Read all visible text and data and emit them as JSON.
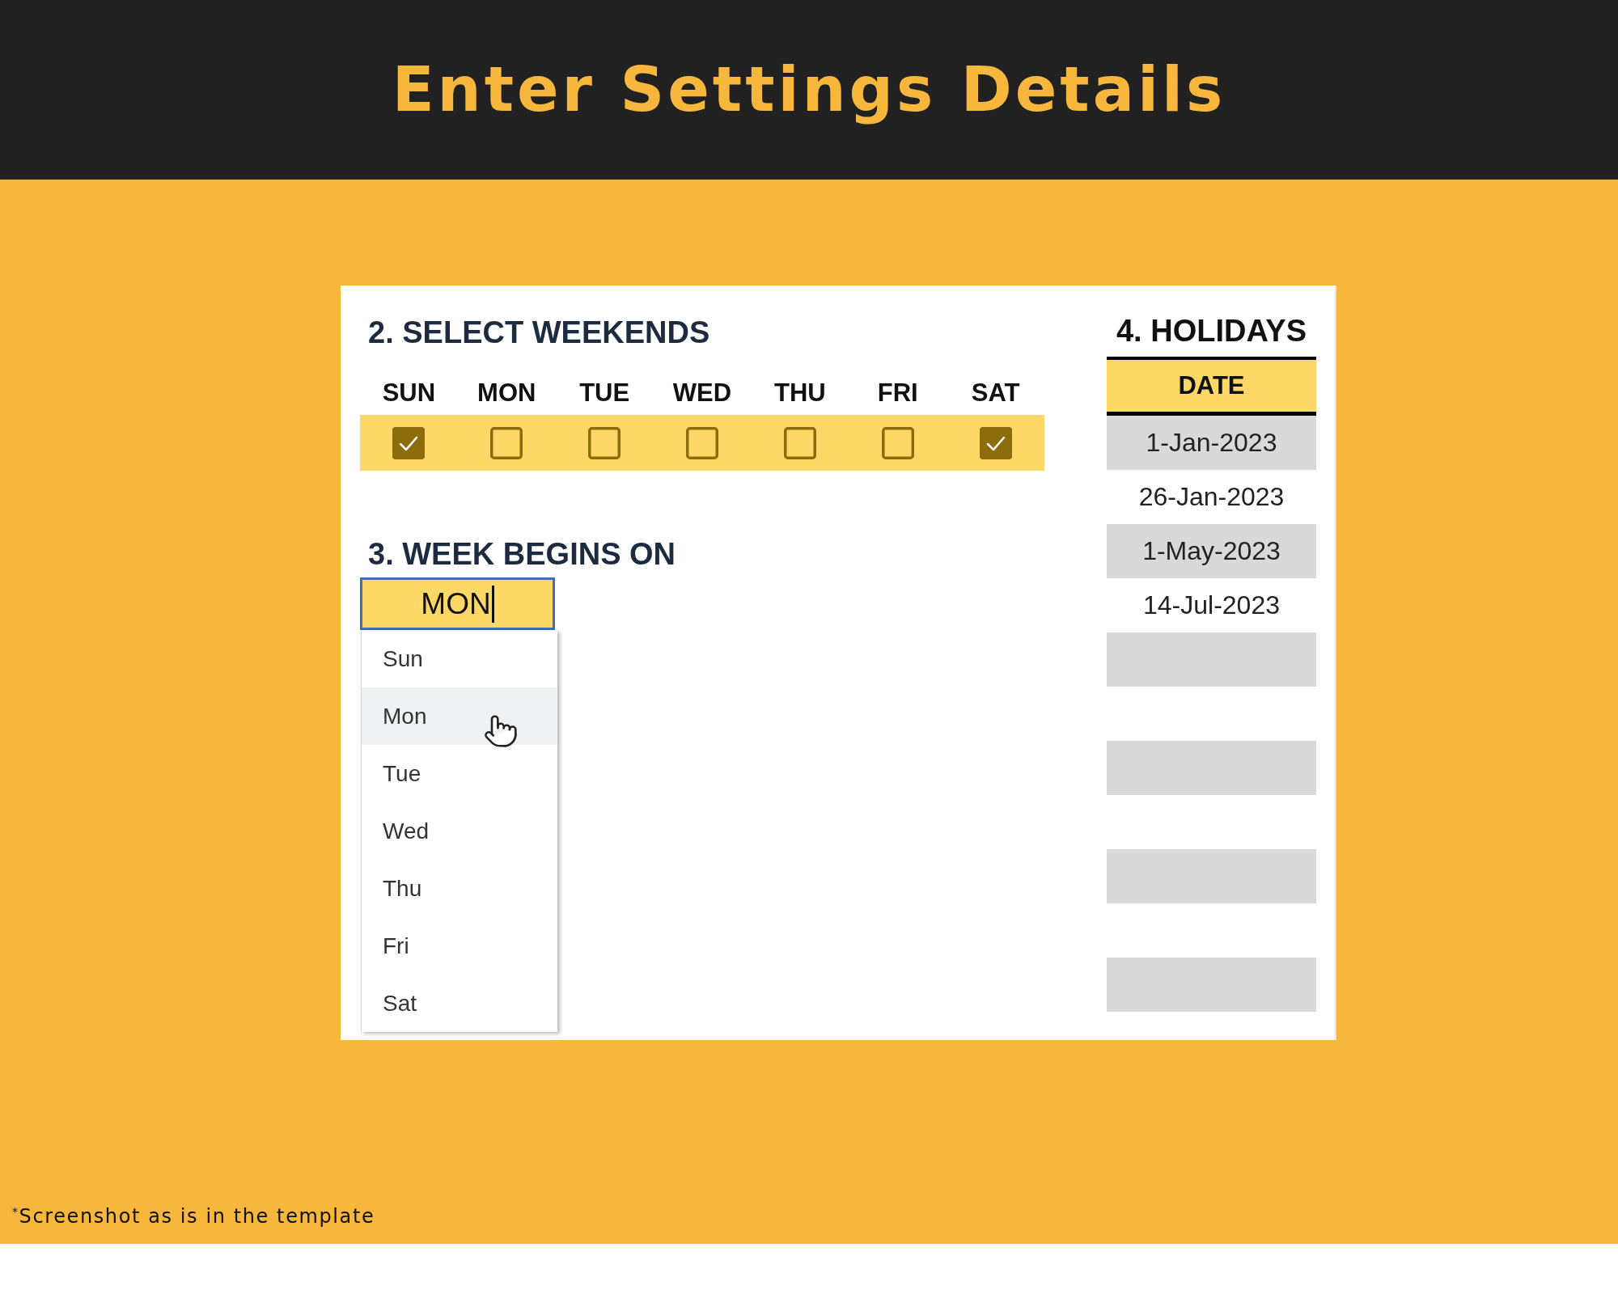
{
  "header": {
    "title": "Enter Settings Details"
  },
  "weekends": {
    "title": "2. SELECT WEEKENDS",
    "days": [
      {
        "label": "SUN",
        "checked": true
      },
      {
        "label": "MON",
        "checked": false
      },
      {
        "label": "TUE",
        "checked": false
      },
      {
        "label": "WED",
        "checked": false
      },
      {
        "label": "THU",
        "checked": false
      },
      {
        "label": "FRI",
        "checked": false
      },
      {
        "label": "SAT",
        "checked": true
      }
    ]
  },
  "week_start": {
    "title": "3. WEEK BEGINS ON",
    "value": "MON",
    "options": [
      {
        "label": "Sun",
        "selected": false
      },
      {
        "label": "Mon",
        "selected": true
      },
      {
        "label": "Tue",
        "selected": false
      },
      {
        "label": "Wed",
        "selected": false
      },
      {
        "label": "Thu",
        "selected": false
      },
      {
        "label": "Fri",
        "selected": false
      },
      {
        "label": "Sat",
        "selected": false
      }
    ]
  },
  "holidays": {
    "title": "4. HOLIDAYS",
    "column": "DATE",
    "rows": [
      {
        "kind": "date",
        "date": "1-Jan-2023"
      },
      {
        "kind": "date",
        "date": "26-Jan-2023"
      },
      {
        "kind": "date",
        "date": "1-May-2023"
      },
      {
        "kind": "date",
        "date": "14-Jul-2023"
      },
      {
        "kind": "blank"
      },
      {
        "kind": "blank"
      },
      {
        "kind": "blank"
      },
      {
        "kind": "blank"
      },
      {
        "kind": "blank"
      },
      {
        "kind": "blank"
      },
      {
        "kind": "blank"
      }
    ]
  },
  "footnote": "$^{*}$Screenshot as is in the template"
}
